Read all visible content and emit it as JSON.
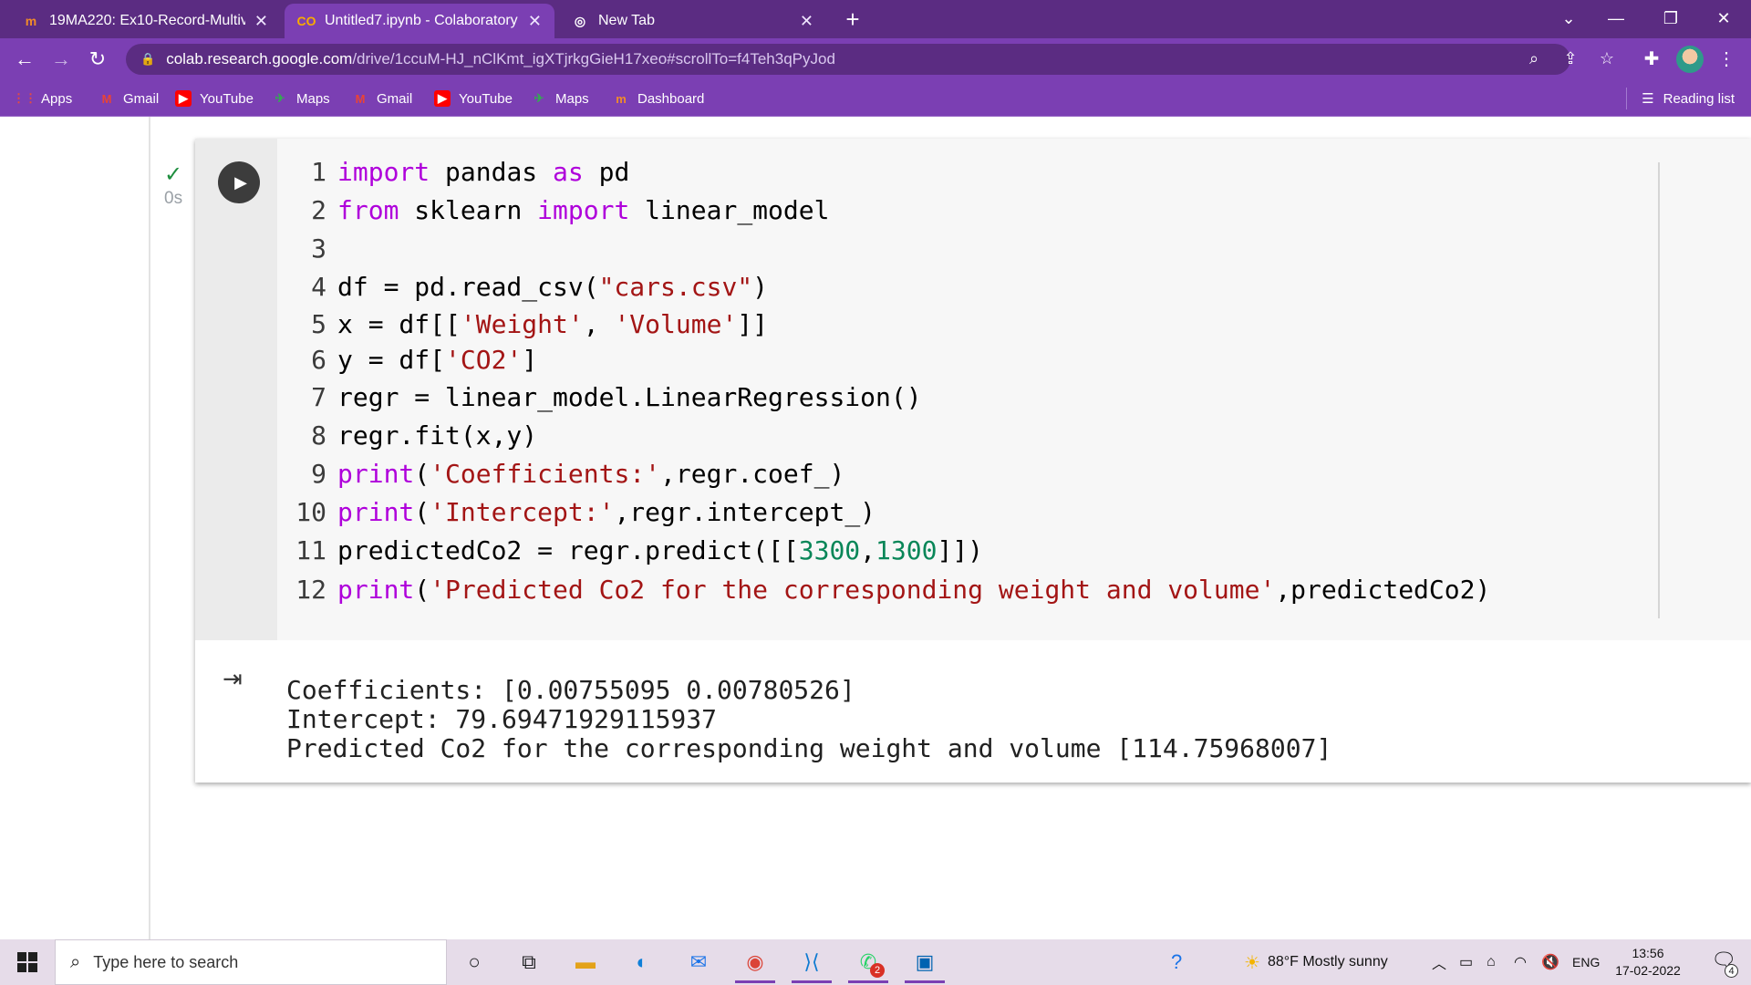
{
  "browser": {
    "tabs": [
      {
        "title": "19MA220: Ex10-Record-Multivari",
        "favicon": "moodle-icon"
      },
      {
        "title": "Untitled7.ipynb - Colaboratory",
        "favicon": "colab-icon"
      },
      {
        "title": "New Tab",
        "favicon": "chrome-icon"
      }
    ],
    "url_host": "colab.research.google.com",
    "url_path": "/drive/1ccuM-HJ_nClKmt_igXTjrkgGieH17xeo#scrollTo=f4Teh3qPyJod",
    "bookmarks": [
      "Apps",
      "Gmail",
      "YouTube",
      "Maps",
      "Gmail",
      "YouTube",
      "Maps",
      "Dashboard"
    ],
    "reading_list": "Reading list",
    "accent_color": "#7b3fb3"
  },
  "cell": {
    "status_time": "0s",
    "code_lines": [
      {
        "n": "1",
        "tokens": [
          {
            "t": "import",
            "c": "kw"
          },
          {
            "t": " pandas ",
            "c": "pl"
          },
          {
            "t": "as",
            "c": "kw"
          },
          {
            "t": " pd",
            "c": "pl"
          }
        ]
      },
      {
        "n": "2",
        "tokens": [
          {
            "t": "from",
            "c": "kw"
          },
          {
            "t": " sklearn ",
            "c": "pl"
          },
          {
            "t": "import",
            "c": "kw"
          },
          {
            "t": " linear_model",
            "c": "pl"
          }
        ]
      },
      {
        "n": "3",
        "tokens": []
      },
      {
        "n": "4",
        "tokens": [
          {
            "t": "df = pd.read_csv(",
            "c": "pl"
          },
          {
            "t": "\"cars.csv\"",
            "c": "str"
          },
          {
            "t": ")",
            "c": "pl"
          }
        ]
      },
      {
        "n": "5",
        "tokens": [
          {
            "t": "x = df[[",
            "c": "pl"
          },
          {
            "t": "'Weight'",
            "c": "str"
          },
          {
            "t": ", ",
            "c": "pl"
          },
          {
            "t": "'Volume'",
            "c": "str"
          },
          {
            "t": "]]",
            "c": "pl"
          }
        ]
      },
      {
        "n": "6",
        "tokens": [
          {
            "t": "y = df[",
            "c": "pl"
          },
          {
            "t": "'CO2'",
            "c": "str"
          },
          {
            "t": "]",
            "c": "pl"
          }
        ]
      },
      {
        "n": "7",
        "tokens": [
          {
            "t": "regr = linear_model.LinearRegression()",
            "c": "pl"
          }
        ]
      },
      {
        "n": "8",
        "tokens": [
          {
            "t": "regr.fit(x,y)",
            "c": "pl"
          }
        ]
      },
      {
        "n": "9",
        "tokens": [
          {
            "t": "print",
            "c": "kw"
          },
          {
            "t": "(",
            "c": "pl"
          },
          {
            "t": "'Coefficients:'",
            "c": "str"
          },
          {
            "t": ",regr.coef_)",
            "c": "pl"
          }
        ]
      },
      {
        "n": "10",
        "tokens": [
          {
            "t": "print",
            "c": "kw"
          },
          {
            "t": "(",
            "c": "pl"
          },
          {
            "t": "'Intercept:'",
            "c": "str"
          },
          {
            "t": ",regr.intercept_)",
            "c": "pl"
          }
        ]
      },
      {
        "n": "11",
        "tokens": [
          {
            "t": "predictedCo2 = regr.predict([[",
            "c": "pl"
          },
          {
            "t": "3300",
            "c": "num"
          },
          {
            "t": ",",
            "c": "pl"
          },
          {
            "t": "1300",
            "c": "num"
          },
          {
            "t": "]])",
            "c": "pl"
          }
        ]
      },
      {
        "n": "12",
        "tokens": [
          {
            "t": "print",
            "c": "kw"
          },
          {
            "t": "(",
            "c": "pl"
          },
          {
            "t": "'Predicted Co2 for the corresponding weight and volume'",
            "c": "str"
          },
          {
            "t": ",predictedCo2)",
            "c": "pl"
          }
        ]
      }
    ],
    "output_lines": [
      "Coefficients: [0.00755095 0.00780526]",
      "Intercept: 79.69471929115937",
      "Predicted Co2 for the corresponding weight and volume [114.75968007]"
    ]
  },
  "taskbar": {
    "search_placeholder": "Type here to search",
    "weather": "88°F  Mostly sunny",
    "language": "ENG",
    "time": "13:56",
    "date": "17-02-2022",
    "whatsapp_badge": "2",
    "notification_count": "4",
    "apps": [
      "cortana-icon",
      "task-view-icon",
      "file-explorer-icon",
      "edge-icon",
      "mail-icon",
      "chrome-icon",
      "vscode-icon",
      "whatsapp-icon",
      "photos-icon"
    ]
  }
}
